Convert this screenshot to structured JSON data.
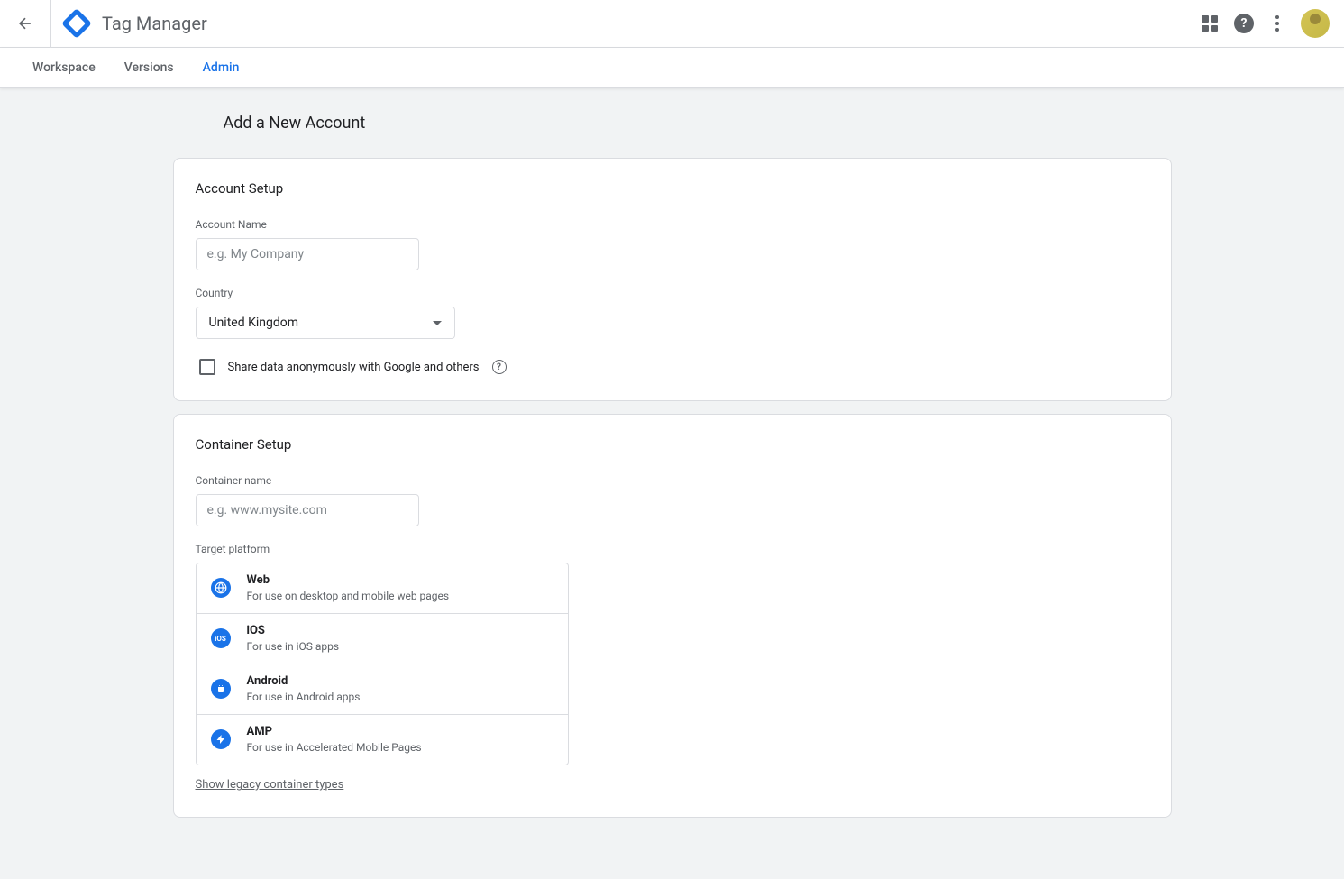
{
  "header": {
    "app_title": "Tag Manager"
  },
  "tabs": [
    {
      "label": "Workspace",
      "active": false
    },
    {
      "label": "Versions",
      "active": false
    },
    {
      "label": "Admin",
      "active": true
    }
  ],
  "page": {
    "title": "Add a New Account"
  },
  "account_setup": {
    "title": "Account Setup",
    "name_label": "Account Name",
    "name_placeholder": "e.g. My Company",
    "name_value": "",
    "country_label": "Country",
    "country_value": "United Kingdom",
    "share_label": "Share data anonymously with Google and others"
  },
  "container_setup": {
    "title": "Container Setup",
    "name_label": "Container name",
    "name_placeholder": "e.g. www.mysite.com",
    "name_value": "",
    "platform_label": "Target platform",
    "platforms": [
      {
        "name": "Web",
        "desc": "For use on desktop and mobile web pages",
        "icon": "web"
      },
      {
        "name": "iOS",
        "desc": "For use in iOS apps",
        "icon": "ios"
      },
      {
        "name": "Android",
        "desc": "For use in Android apps",
        "icon": "android"
      },
      {
        "name": "AMP",
        "desc": "For use in Accelerated Mobile Pages",
        "icon": "amp"
      }
    ],
    "legacy_link": "Show legacy container types"
  }
}
